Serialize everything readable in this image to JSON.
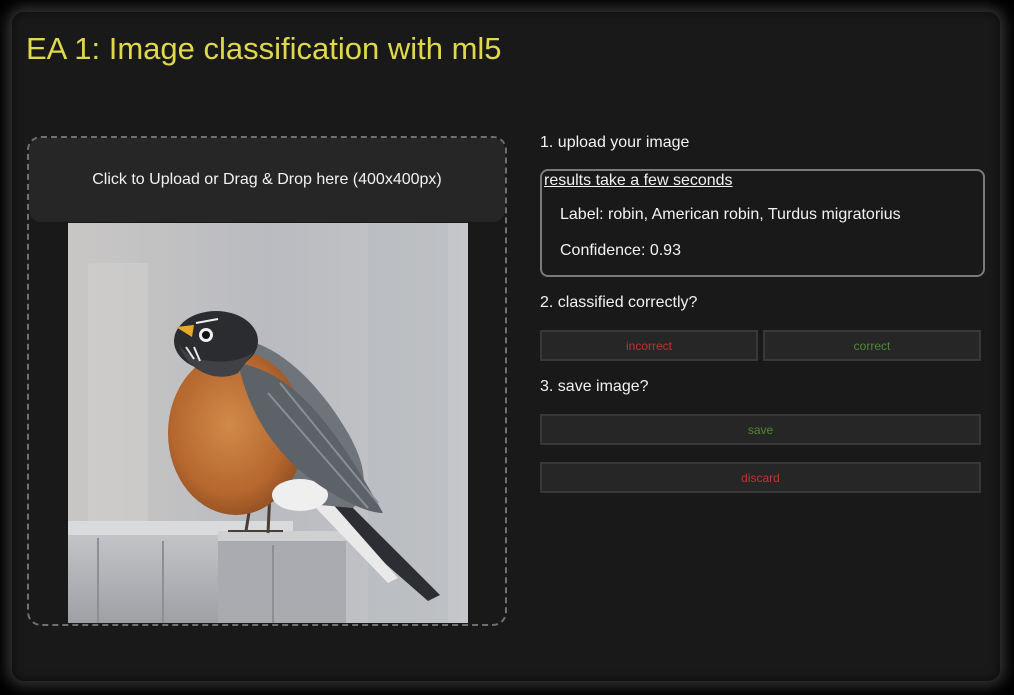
{
  "page": {
    "title": "EA 1: Image classification with ml5"
  },
  "upload": {
    "dropzone_label": "Click to Upload or Drag & Drop here (400x400px)",
    "image_subject": "robin"
  },
  "steps": {
    "step1": "1. upload your image",
    "step2": "2. classified correctly?",
    "step3": "3. save image?"
  },
  "results": {
    "note": "results take a few seconds",
    "label_line": "Label: robin, American robin, Turdus migratorius",
    "confidence_line": "Confidence: 0.93"
  },
  "buttons": {
    "incorrect": "incorrect",
    "correct": "correct",
    "save": "save",
    "discard": "discard"
  },
  "colors": {
    "title": "#dfd84a",
    "negative": "#c43030",
    "positive": "#4f8a32",
    "background": "#191919"
  }
}
